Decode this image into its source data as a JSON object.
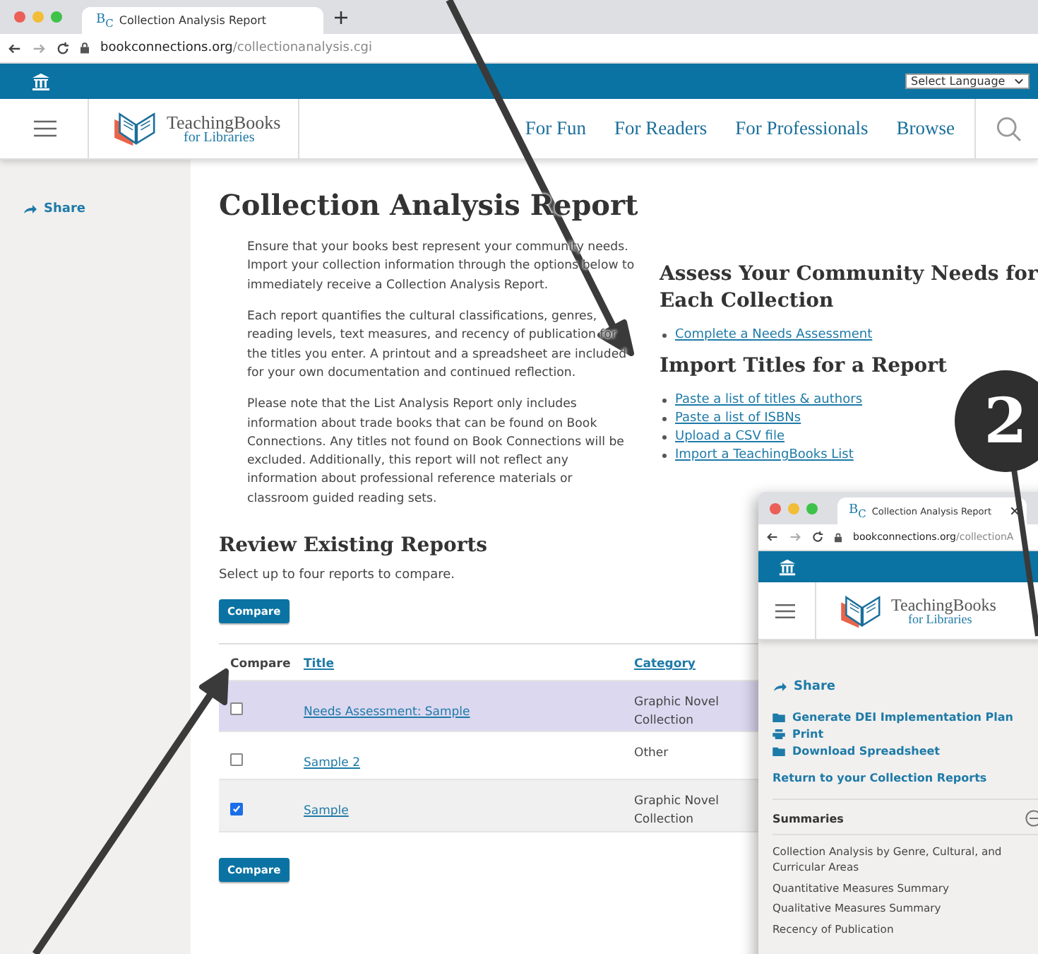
{
  "browser": {
    "tabs": [
      {
        "favicon": "B$_{C}$",
        "title": "Collection Analysis Report",
        "selected": true
      }
    ],
    "url_host": "bookconnections.org",
    "url_path": "/collectionanalysis.cgi"
  },
  "site": {
    "language_select": "Select Language",
    "logo": {
      "name": "TeachingBooks",
      "sub": "for Libraries"
    },
    "nav": [
      "For Fun",
      "For Readers",
      "For Professionals",
      "Browse"
    ]
  },
  "sidebar": {
    "share": "Share"
  },
  "main": {
    "title": "Collection Analysis Report",
    "paragraphs": [
      "Ensure that your books best represent your community needs. Import your collection information through the options below to immediately receive a Collection Analysis Report.",
      "Each report quantifies the cultural classifications, genres, reading levels, text measures, and recency of publication for the titles you enter. A printout and a spreadsheet are included for your own documentation and continued reflection.",
      "Please note that the List Analysis Report only includes information about trade books that can be found on Book Connections. Any titles not found on Book Connections will be excluded. Additionally, this report will not reflect any information about professional reference materials or classroom guided reading sets."
    ],
    "assess": {
      "heading": "Assess Your Community Needs for Each Collection",
      "links": [
        "Complete a Needs Assessment"
      ]
    },
    "import": {
      "heading": "Import Titles for a Report",
      "links": [
        "Paste a list of titles & authors",
        "Paste a list of ISBNs",
        "Upload a CSV file",
        "Import a TeachingBooks List"
      ]
    },
    "review": {
      "heading": "Review Existing Reports",
      "hint": "Select up to four reports to compare.",
      "compare_top": "Compare",
      "compare_bottom": "Compare",
      "columns": [
        "Compare",
        "Title",
        "Category"
      ],
      "rows": [
        {
          "checked": false,
          "selected": true,
          "title": "Needs Assessment: Sample",
          "category": "Graphic Novel Collection"
        },
        {
          "checked": false,
          "selected": false,
          "title": "Sample 2",
          "category": "Other"
        },
        {
          "checked": true,
          "selected": false,
          "title": "Sample",
          "category": "Graphic Novel Collection"
        }
      ]
    }
  },
  "inset": {
    "tab_favicon": "B$_{C}$",
    "tab_title": "Collection Analysis Report",
    "url_host": "bookconnections.org",
    "url_path": "/collectionA",
    "logo": {
      "name": "TeachingBooks",
      "sub": "for Libraries"
    },
    "share": "Share",
    "actions": [
      {
        "kind": "folder",
        "label": "Generate DEI Implementation Plan"
      },
      {
        "kind": "print",
        "label": "Print"
      },
      {
        "kind": "folder",
        "label": "Download Spreadsheet"
      }
    ],
    "return_link": "Return to your Collection Reports",
    "summaries": {
      "heading": "Summaries",
      "expanded": true,
      "items": [
        "Collection Analysis by Genre, Cultural, and Curricular Areas",
        "Quantitative Measures Summary",
        "Qualitative Measures Summary",
        "Recency of Publication"
      ]
    }
  },
  "badge": "2"
}
